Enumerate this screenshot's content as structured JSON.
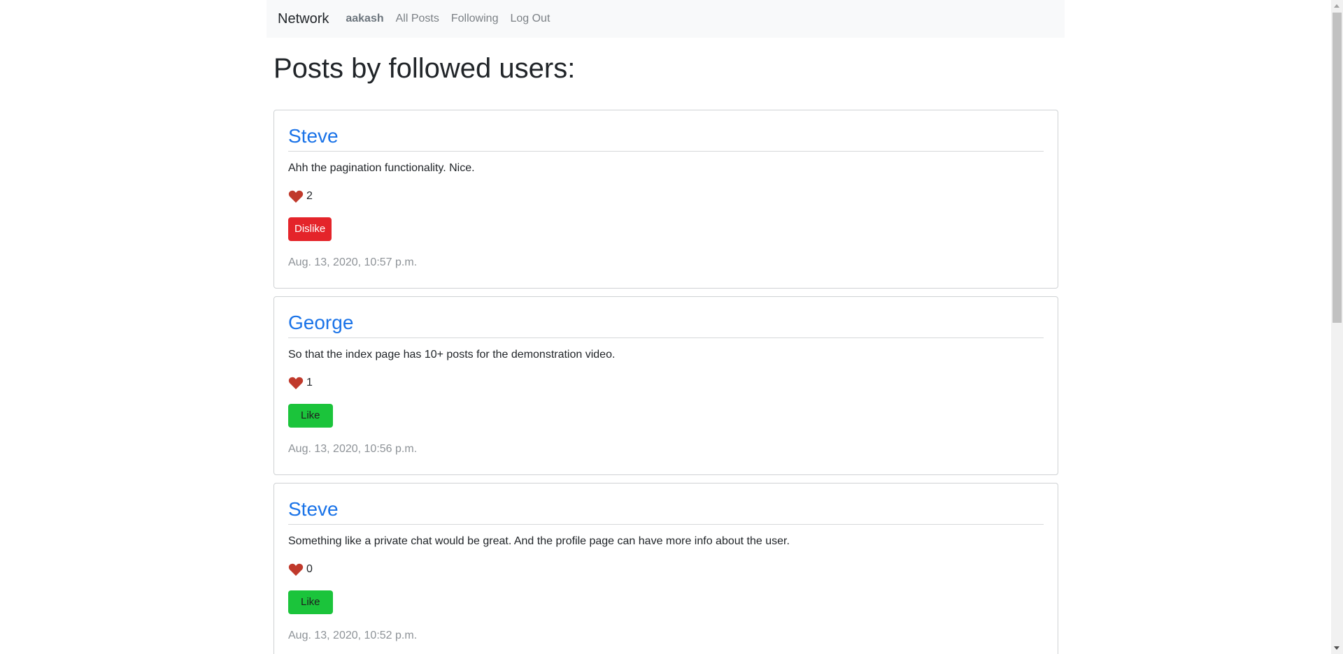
{
  "navbar": {
    "brand": "Network",
    "user": "aakash",
    "links": [
      "All Posts",
      "Following",
      "Log Out"
    ]
  },
  "page": {
    "title": "Posts by followed users:"
  },
  "posts": [
    {
      "author": "Steve",
      "content": "Ahh the pagination functionality. Nice.",
      "likes": "2",
      "button": "Dislike",
      "timestamp": "Aug. 13, 2020, 10:57 p.m."
    },
    {
      "author": "George",
      "content": "So that the index page has 10+ posts for the demonstration video.",
      "likes": "1",
      "button": "Like",
      "timestamp": "Aug. 13, 2020, 10:56 p.m."
    },
    {
      "author": "Steve",
      "content": "Something like a private chat would be great. And the profile page can have more info about the user.",
      "likes": "0",
      "button": "Like",
      "timestamp": "Aug. 13, 2020, 10:52 p.m."
    }
  ],
  "colors": {
    "navbar_bg": "#f8f9fa",
    "link_blue": "#1a73e8",
    "dislike_red": "#e4242a",
    "like_green": "#1bc43b",
    "heart_red": "#c0392b"
  }
}
